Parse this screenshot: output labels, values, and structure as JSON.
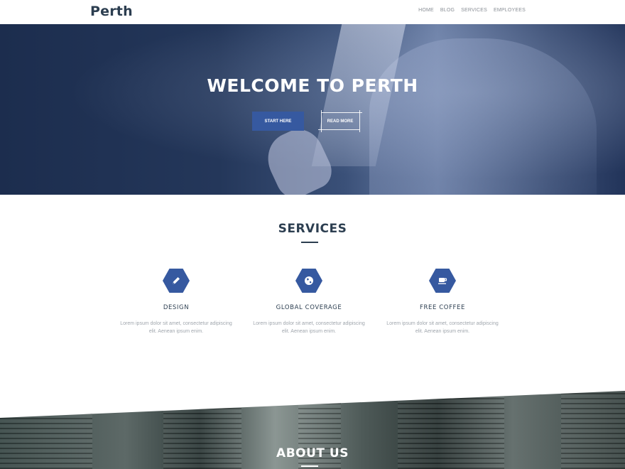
{
  "header": {
    "logo": "Perth",
    "nav": [
      "HOME",
      "BLOG",
      "SERVICES",
      "EMPLOYEES"
    ]
  },
  "hero": {
    "title": "WELCOME TO PERTH",
    "primary_button": "START HERE",
    "secondary_button": "READ MORE"
  },
  "services": {
    "title": "SERVICES",
    "items": [
      {
        "icon": "pencil-icon",
        "name": "DESIGN",
        "desc": "Lorem ipsum dolor sit amet, consectetur adipiscing elit. Aenean ipsum enim."
      },
      {
        "icon": "globe-icon",
        "name": "GLOBAL COVERAGE",
        "desc": "Lorem ipsum dolor sit amet, consectetur adipiscing elit. Aenean ipsum enim."
      },
      {
        "icon": "coffee-icon",
        "name": "FREE COFFEE",
        "desc": "Lorem ipsum dolor sit amet, consectetur adipiscing elit. Aenean ipsum enim."
      }
    ]
  },
  "about": {
    "title": "ABOUT US"
  },
  "colors": {
    "accent": "#3659a0",
    "heading": "#2c3e50",
    "hero_overlay": "#1c2d4e"
  }
}
